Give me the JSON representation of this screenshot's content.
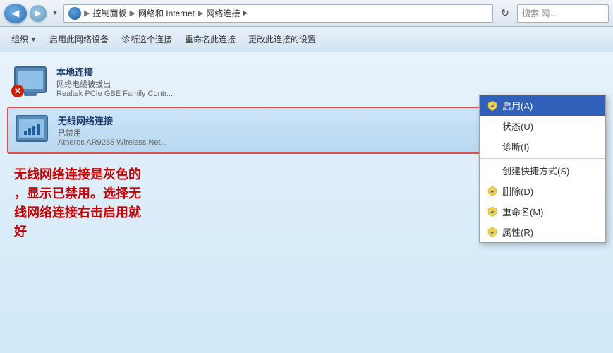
{
  "addressbar": {
    "breadcrumb": [
      {
        "label": "控制面板"
      },
      {
        "label": "网络和 Internet"
      },
      {
        "label": "网络连接"
      }
    ],
    "search_placeholder": "搜索 网...",
    "refresh_symbol": "↻"
  },
  "toolbar": {
    "items": [
      {
        "label": "组织",
        "has_dropdown": true
      },
      {
        "label": "启用此网络设备",
        "has_dropdown": false
      },
      {
        "label": "诊断这个连接",
        "has_dropdown": false
      },
      {
        "label": "重命名此连接",
        "has_dropdown": false
      },
      {
        "label": "更改此连接的设置",
        "has_dropdown": false
      }
    ]
  },
  "connections": [
    {
      "name": "本地连接",
      "status": "网络电缆被拔出",
      "adapter": "Realtek PCIe GBE Family Contr...",
      "type": "wired",
      "disabled": false,
      "error": true
    },
    {
      "name": "无线网络连接",
      "status": "已禁用",
      "adapter": "Atheros AR9285 Wireless Net...",
      "type": "wireless",
      "disabled": true,
      "highlighted": true
    }
  ],
  "context_menu": {
    "items": [
      {
        "label": "启用(A)",
        "shortcut": "",
        "has_shield": true,
        "highlighted": true
      },
      {
        "label": "状态(U)",
        "shortcut": "",
        "has_shield": false,
        "highlighted": false
      },
      {
        "label": "诊断(I)",
        "shortcut": "",
        "has_shield": false,
        "highlighted": false
      },
      {
        "separator": true
      },
      {
        "label": "创建快捷方式(S)",
        "shortcut": "",
        "has_shield": false,
        "highlighted": false
      },
      {
        "label": "删除(D)",
        "shortcut": "",
        "has_shield": true,
        "highlighted": false
      },
      {
        "label": "重命名(M)",
        "shortcut": "",
        "has_shield": true,
        "highlighted": false
      },
      {
        "label": "属性(R)",
        "shortcut": "",
        "has_shield": true,
        "highlighted": false
      }
    ]
  },
  "annotation": {
    "text": "无线网络连接是灰色的\n，显示已禁用。选择无\n线网络连接右击启用就\n好"
  }
}
